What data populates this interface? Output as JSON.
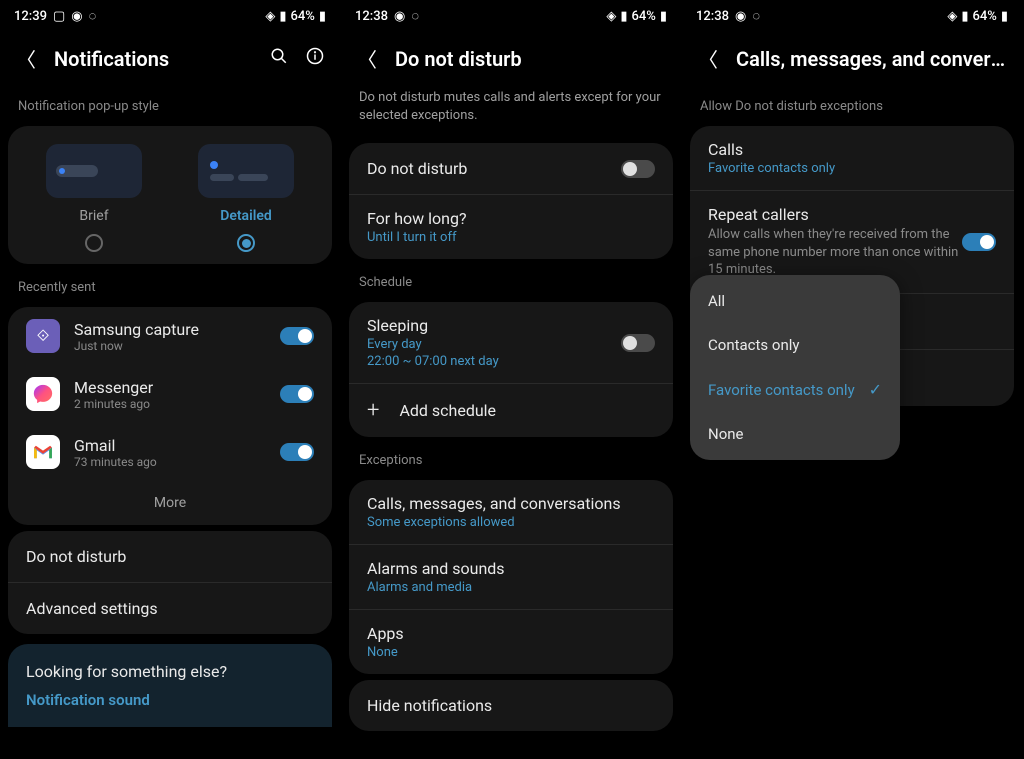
{
  "screens": [
    {
      "status": {
        "time": "12:39",
        "battery": "64%"
      },
      "header": {
        "title": "Notifications"
      },
      "popup_label": "Notification pop-up style",
      "popup_options": {
        "brief": "Brief",
        "detailed": "Detailed"
      },
      "recently_sent_label": "Recently sent",
      "apps": [
        {
          "name": "Samsung capture",
          "time": "Just now"
        },
        {
          "name": "Messenger",
          "time": "2 minutes ago"
        },
        {
          "name": "Gmail",
          "time": "73 minutes ago"
        }
      ],
      "more": "More",
      "dnd": "Do not disturb",
      "advanced": "Advanced settings",
      "highlight": {
        "title": "Looking for something else?",
        "link": "Notification sound"
      }
    },
    {
      "status": {
        "time": "12:38",
        "battery": "64%"
      },
      "header": {
        "title": "Do not disturb"
      },
      "description": "Do not disturb mutes calls and alerts except for your selected exceptions.",
      "dnd_toggle": "Do not disturb",
      "how_long": {
        "title": "For how long?",
        "subtitle": "Until I turn it off"
      },
      "schedule_label": "Schedule",
      "sleeping": {
        "title": "Sleeping",
        "line1": "Every day",
        "line2": "22:00 ~ 07:00 next day"
      },
      "add_schedule": "Add schedule",
      "exceptions_label": "Exceptions",
      "calls_msgs": {
        "title": "Calls, messages, and conversations",
        "subtitle": "Some exceptions allowed"
      },
      "alarms": {
        "title": "Alarms and sounds",
        "subtitle": "Alarms and media"
      },
      "apps_row": {
        "title": "Apps",
        "subtitle": "None"
      },
      "hide": "Hide notifications"
    },
    {
      "status": {
        "time": "12:38",
        "battery": "64%"
      },
      "header": {
        "title": "Calls, messages, and conversa…"
      },
      "section_label": "Allow Do not disturb exceptions",
      "calls": {
        "title": "Calls",
        "subtitle": "Favorite contacts only"
      },
      "repeat": {
        "title": "Repeat callers",
        "subtitle": "Allow calls when they're received from the same phone number more than once within 15 minutes."
      },
      "dropdown": {
        "all": "All",
        "contacts": "Contacts only",
        "favorite": "Favorite contacts only",
        "none": "None"
      }
    }
  ]
}
